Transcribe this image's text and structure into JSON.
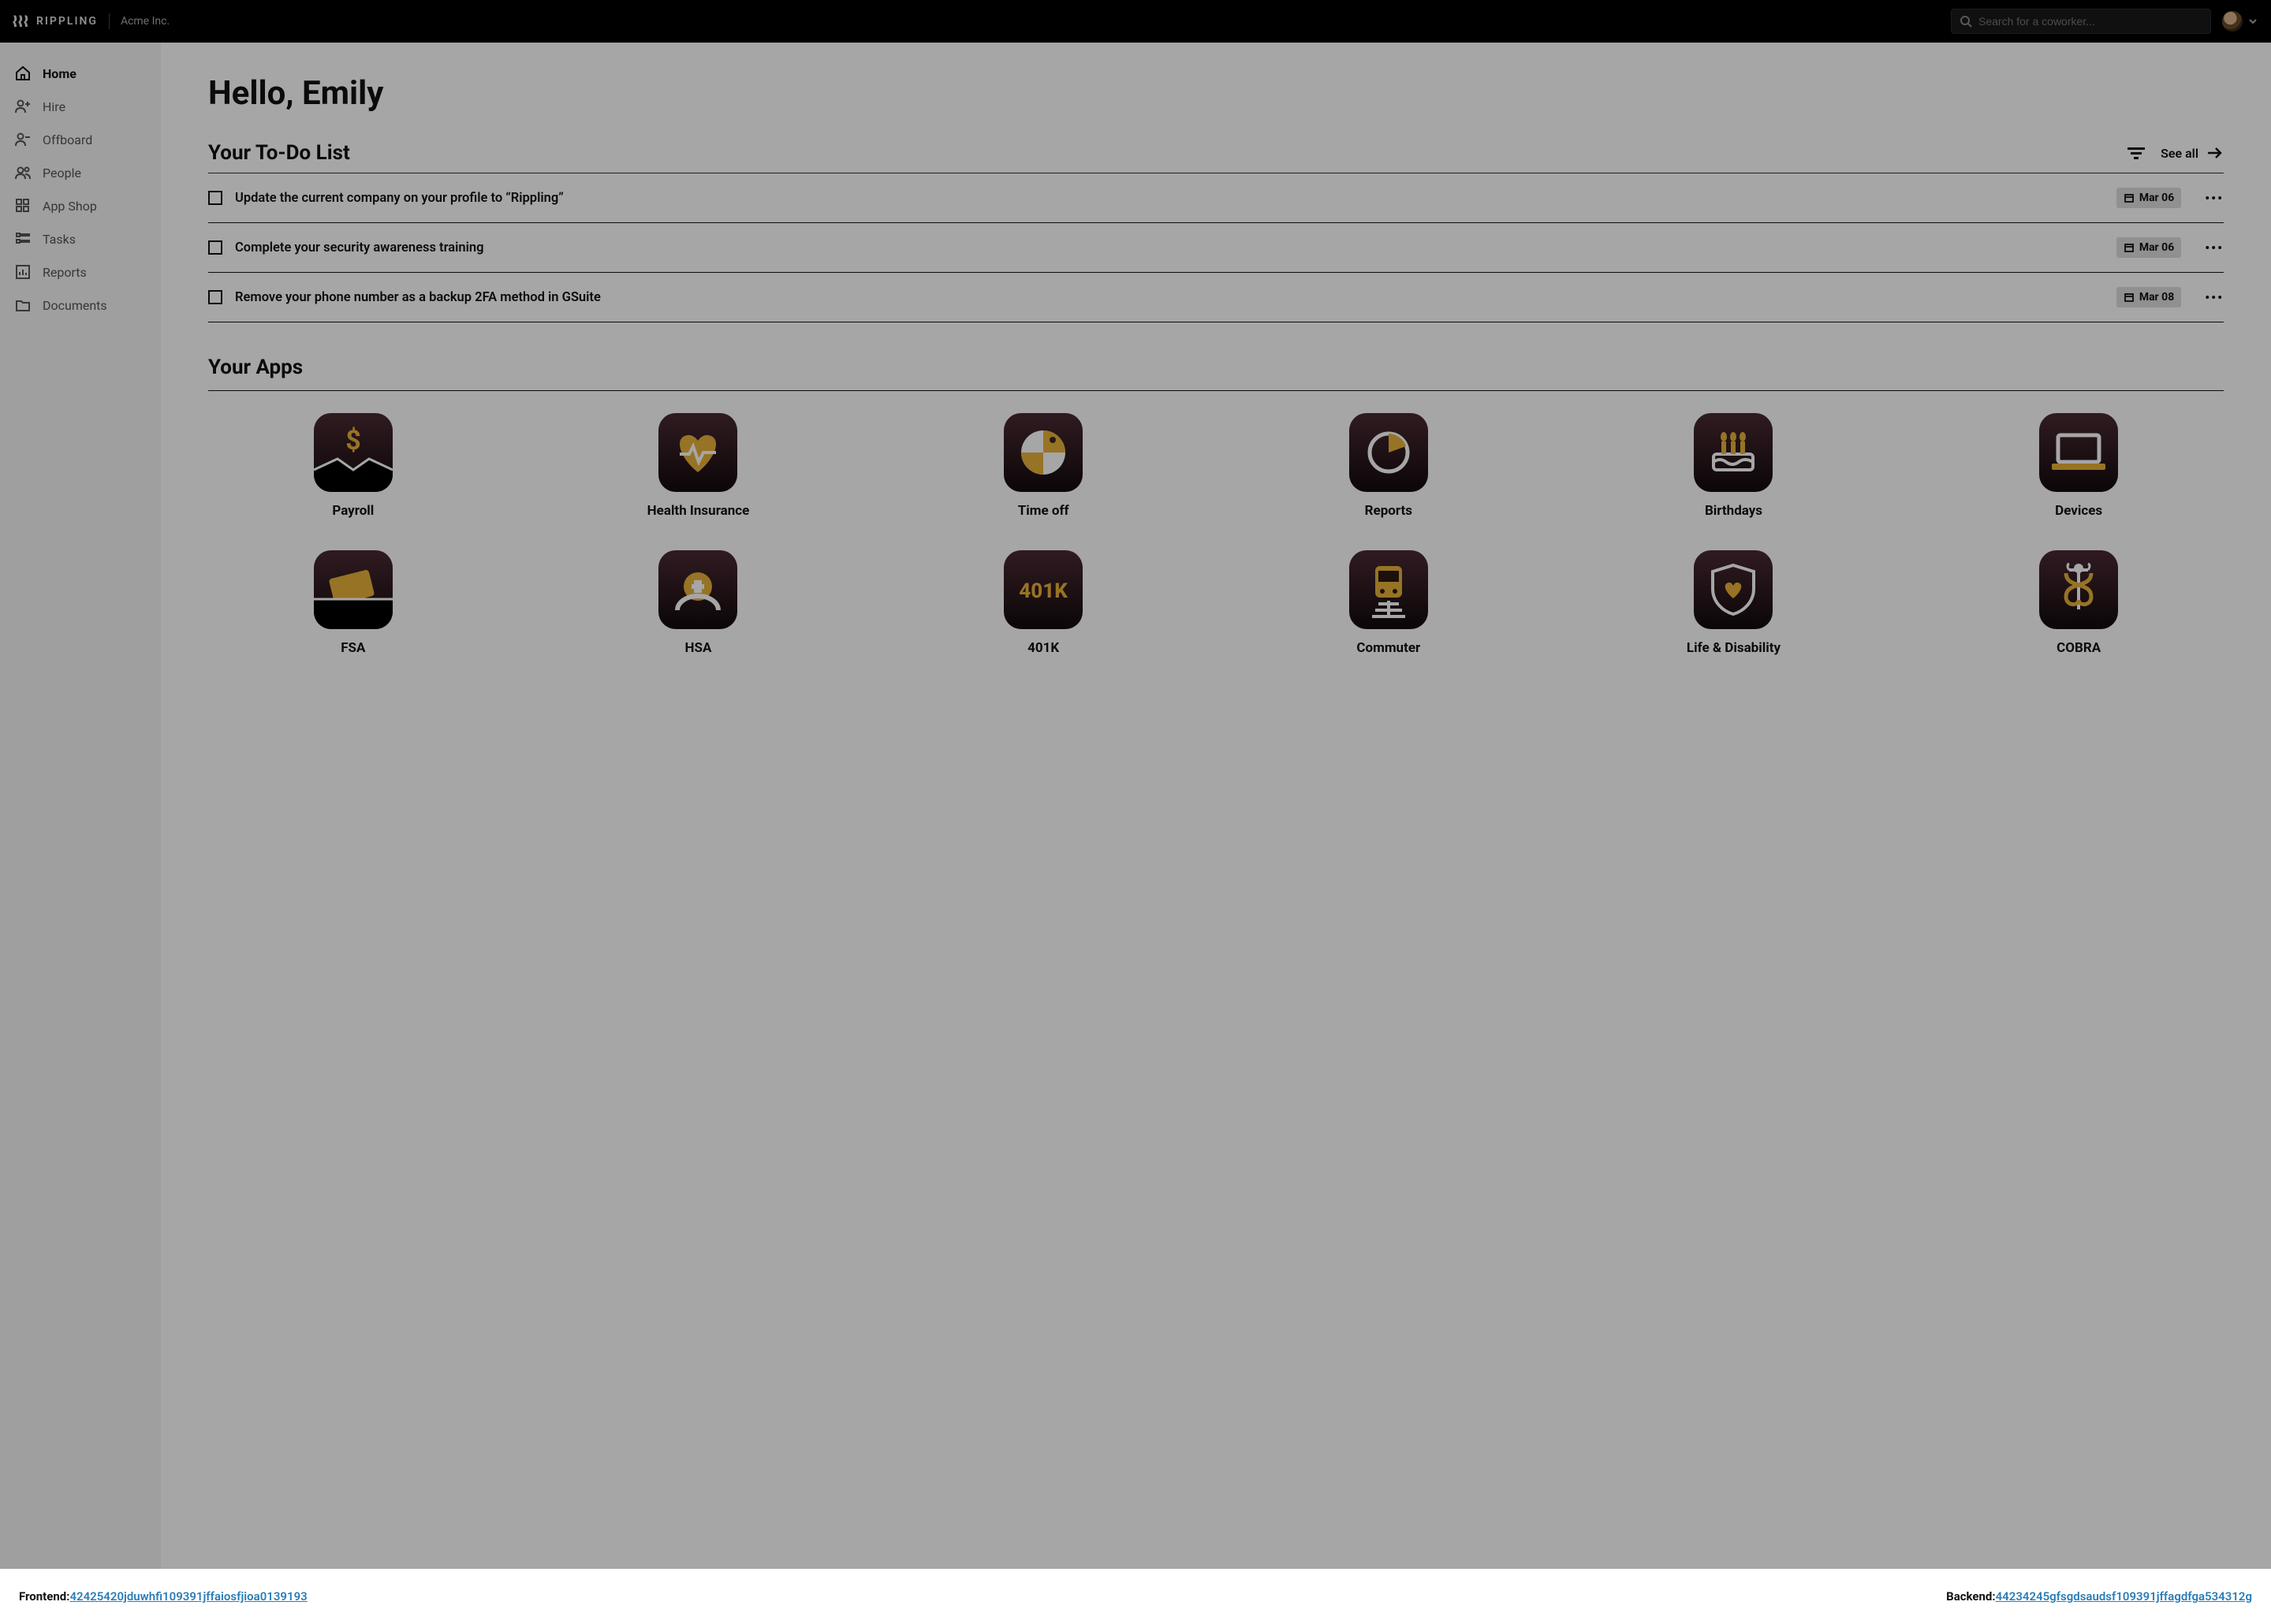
{
  "header": {
    "brand": "RIPPLING",
    "company": "Acme Inc.",
    "search_placeholder": "Search for a coworker..."
  },
  "sidebar": {
    "items": [
      {
        "label": "Home",
        "icon": "home-icon",
        "active": true
      },
      {
        "label": "Hire",
        "icon": "person-plus-icon"
      },
      {
        "label": "Offboard",
        "icon": "person-minus-icon"
      },
      {
        "label": "People",
        "icon": "people-icon"
      },
      {
        "label": "App Shop",
        "icon": "grid-icon"
      },
      {
        "label": "Tasks",
        "icon": "tasks-icon"
      },
      {
        "label": "Reports",
        "icon": "chart-icon"
      },
      {
        "label": "Documents",
        "icon": "folder-icon"
      }
    ]
  },
  "main": {
    "greeting": "Hello, Emily",
    "todo": {
      "title": "Your To-Do List",
      "see_all": "See all",
      "items": [
        {
          "label": "Update the current company on your profile to “Rippling”",
          "date": "Mar 06"
        },
        {
          "label": "Complete your security awareness training",
          "date": "Mar 06"
        },
        {
          "label": "Remove your phone number as a backup 2FA method in GSuite",
          "date": "Mar 08"
        }
      ]
    },
    "apps": {
      "title": "Your Apps",
      "items": [
        {
          "label": "Payroll",
          "icon": "payroll"
        },
        {
          "label": "Health Insurance",
          "icon": "health"
        },
        {
          "label": "Time off",
          "icon": "timeoff"
        },
        {
          "label": "Reports",
          "icon": "reports"
        },
        {
          "label": "Birthdays",
          "icon": "birthdays"
        },
        {
          "label": "Devices",
          "icon": "devices"
        },
        {
          "label": "FSA",
          "icon": "fsa"
        },
        {
          "label": "HSA",
          "icon": "hsa"
        },
        {
          "label": "401K",
          "icon": "401k"
        },
        {
          "label": "Commuter",
          "icon": "commuter"
        },
        {
          "label": "Life & Disability",
          "icon": "life"
        },
        {
          "label": "COBRA",
          "icon": "cobra"
        }
      ]
    }
  },
  "footer": {
    "frontend_label": "Frontend: ",
    "frontend_hash": "42425420jduwhfi109391jffaiosfjioa0139193",
    "backend_label": "Backend: ",
    "backend_hash": "44234245gfsgdsaudsf109391jffagdfga534312g"
  },
  "colors": {
    "accent": "#e8b13a"
  }
}
